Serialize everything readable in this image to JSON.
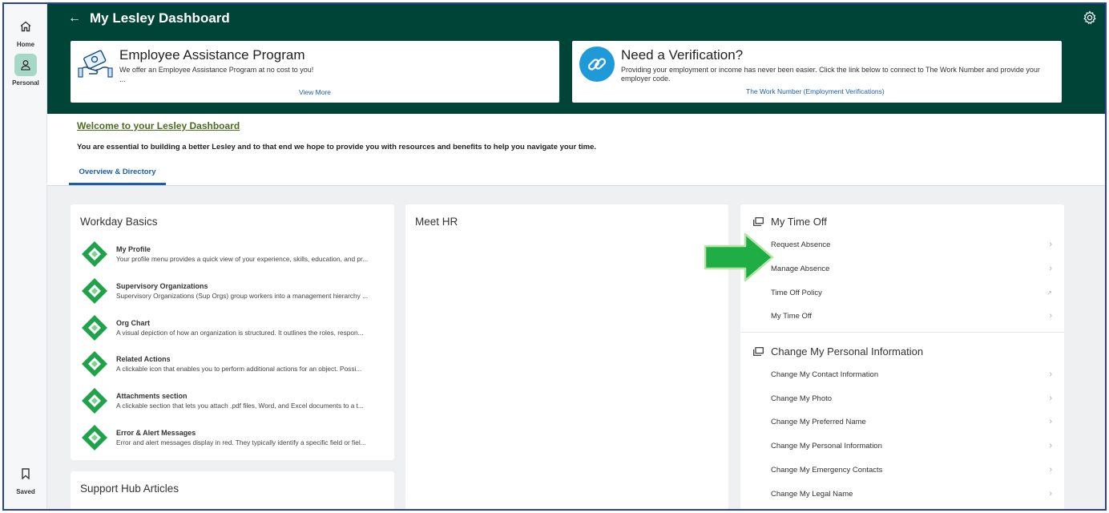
{
  "rail": {
    "home": "Home",
    "personal": "Personal",
    "saved": "Saved"
  },
  "header": {
    "title": "My Lesley Dashboard"
  },
  "cards": {
    "eap": {
      "title": "Employee Assistance Program",
      "desc": "We offer an Employee Assistance Program at no cost to you!",
      "ellipsis": "...",
      "link": "View More"
    },
    "verify": {
      "title": "Need a Verification?",
      "desc": "Providing your employment or income has never been easier. Click the link below to connect to The Work Number and provide your employer code.",
      "link": "The Work Number (Employment Verifications)"
    }
  },
  "welcome": {
    "title": "Welcome to your Lesley Dashboard",
    "text": "You are essential to building a better Lesley and to that end we hope to provide you with resources and benefits to help you navigate your time.",
    "tab": "Overview & Directory"
  },
  "workday_basics": {
    "title": "Workday Basics",
    "items": [
      {
        "name": "My Profile",
        "desc": "Your profile menu provides a quick view of your experience, skills, education, and pr..."
      },
      {
        "name": "Supervisory Organizations",
        "desc": "Supervisory Organizations (Sup Orgs) group workers into a management hierarchy ..."
      },
      {
        "name": "Org Chart",
        "desc": "A visual depiction of how an organization is structured. It outlines the roles, respon..."
      },
      {
        "name": "Related Actions",
        "desc": "A clickable icon that enables you to perform additional actions for an object. Possi..."
      },
      {
        "name": "Attachments section",
        "desc": "A clickable section that lets you attach .pdf files, Word, and Excel documents to a t..."
      },
      {
        "name": "Error & Alert Messages",
        "desc": "Error and alert messages display in red. They typically identify a specific field or fiel..."
      }
    ]
  },
  "support": {
    "title": "Support Hub Articles"
  },
  "meet_hr": {
    "title": "Meet HR"
  },
  "time_off": {
    "title": "My Time Off",
    "items": [
      "Request Absence",
      "Manage Absence",
      "Time Off Policy",
      "My Time Off"
    ]
  },
  "personal_info": {
    "title": "Change My Personal Information",
    "items": [
      "Change My Contact Information",
      "Change My Photo",
      "Change My Preferred Name",
      "Change My Personal Information",
      "Change My Emergency Contacts",
      "Change My Legal Name"
    ]
  },
  "colors": {
    "header_green": "#004438",
    "link_blue": "#1a5fa8",
    "welcome_green": "#4a6d1f",
    "arrow_green": "#1fae45"
  }
}
